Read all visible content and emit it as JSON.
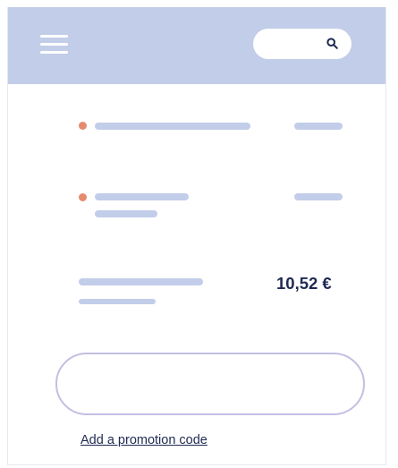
{
  "header": {
    "menu_icon": "hamburger-menu-icon",
    "search_icon": "search-icon",
    "background_color": "#c2cde9"
  },
  "cart": {
    "items": [
      {
        "status_color": "#e58a6f"
      },
      {
        "status_color": "#e58a6f"
      }
    ],
    "total_price": "10,52 €"
  },
  "promotion": {
    "link_label": "Add a promotion code",
    "field_value": ""
  },
  "colors": {
    "placeholder_bar": "#c2cde9",
    "accent_dot": "#e58a6f",
    "text": "#1f2a52",
    "field_border": "#c2bfe2"
  }
}
